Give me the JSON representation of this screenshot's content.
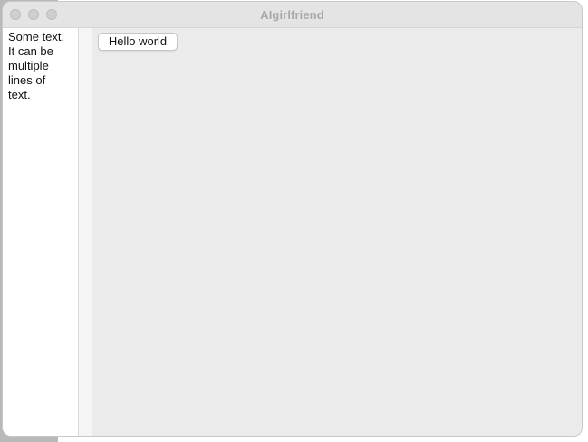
{
  "window": {
    "title": "AIgirlfriend"
  },
  "window_controls": {
    "close": "close-button",
    "minimize": "minimize-button",
    "zoom": "zoom-button"
  },
  "sidebar": {
    "text": "Some text.\nIt can be\nmultiple\nlines of\ntext."
  },
  "main": {
    "button_label": "Hello world"
  }
}
